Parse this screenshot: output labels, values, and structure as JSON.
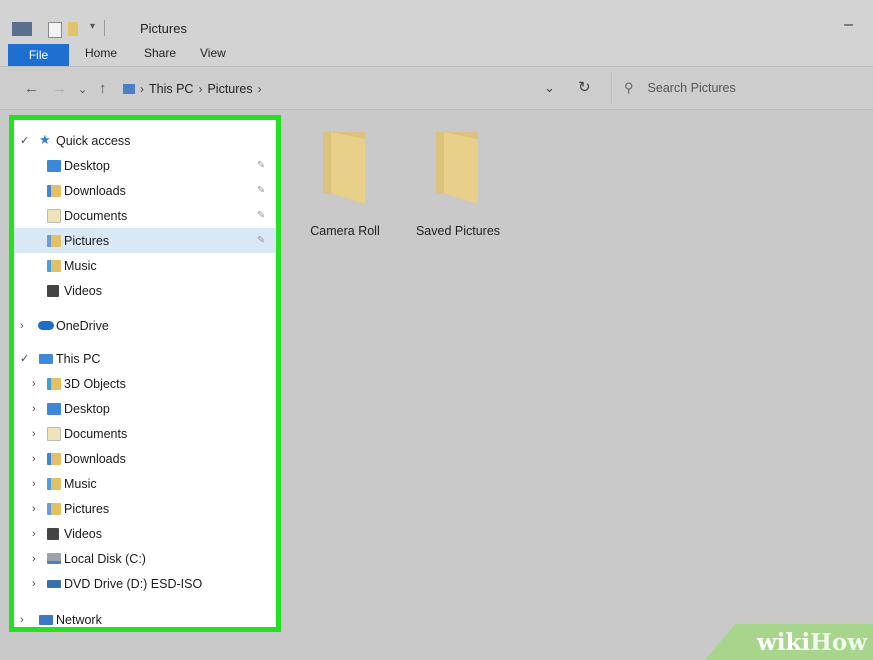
{
  "window": {
    "title": "Pictures"
  },
  "ribbon": {
    "tabs": [
      "File",
      "Home",
      "Share",
      "View"
    ]
  },
  "address": {
    "crumbs": [
      "This PC",
      "Pictures"
    ],
    "search_placeholder": "Search Pictures"
  },
  "nav": {
    "quick_access": "Quick access",
    "quick_items": [
      "Desktop",
      "Downloads",
      "Documents",
      "Pictures",
      "Music",
      "Videos"
    ],
    "onedrive": "OneDrive",
    "this_pc": "This PC",
    "pc_items": [
      "3D Objects",
      "Desktop",
      "Documents",
      "Downloads",
      "Music",
      "Pictures",
      "Videos",
      "Local Disk (C:)",
      "DVD Drive (D:) ESD-ISO"
    ],
    "network": "Network"
  },
  "content": {
    "folders": [
      "Camera Roll",
      "Saved Pictures"
    ]
  },
  "watermark": {
    "part1": "wiki",
    "part2": "How"
  },
  "colors": {
    "highlight_border": "#22e222",
    "file_tab": "#1f6fd0",
    "selected_row": "#d9e8f5",
    "folder": "#e8cf8a"
  }
}
